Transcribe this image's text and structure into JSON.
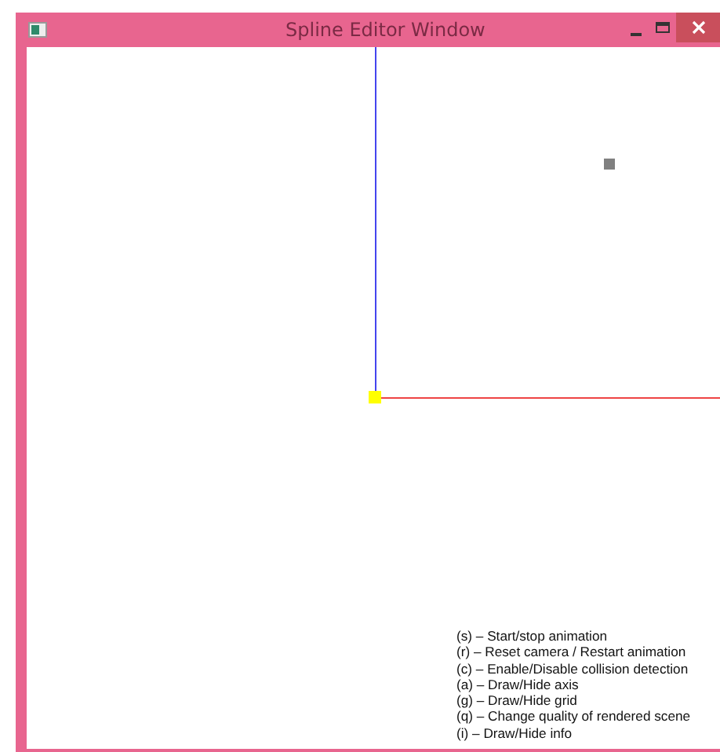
{
  "window": {
    "title": "Spline Editor Window"
  },
  "help_lines": [
    "(s) – Start/stop animation",
    "(r) – Reset camera / Restart animation",
    "(c) – Enable/Disable collision detection",
    "(a) – Draw/Hide axis",
    "(g) – Draw/Hide grid",
    "(q) – Change quality of rendered scene",
    "(i) – Draw/Hide info"
  ]
}
